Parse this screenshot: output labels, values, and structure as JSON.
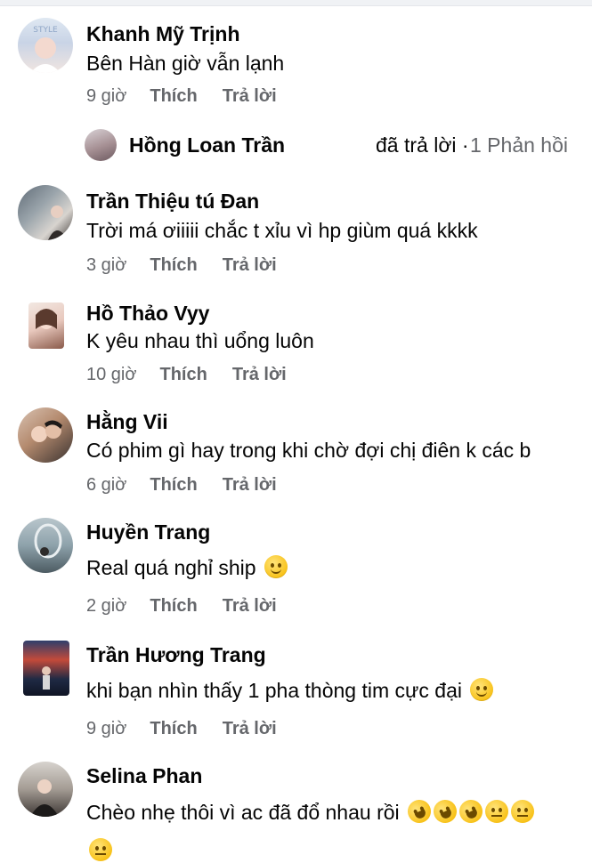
{
  "comments": [
    {
      "name": "Khanh Mỹ Trịnh",
      "text": "Bên Hàn giờ vẫn lạnh",
      "time": "9 giờ",
      "like": "Thích",
      "reply": "Trả lời",
      "avatar_icon": "profile-photo"
    },
    {
      "name": "Trần Thiệu tú Đan",
      "text": "Trời má ơiiiii chắc t xỉu vì hp giùm quá kkkk",
      "time": "3 giờ",
      "like": "Thích",
      "reply": "Trả lời",
      "avatar_icon": "profile-photo"
    },
    {
      "name": "Hồ Thảo Vyy",
      "text": "K yêu nhau thì uổng luôn",
      "time": "10 giờ",
      "like": "Thích",
      "reply": "Trả lời",
      "avatar_icon": "profile-photo"
    },
    {
      "name": "Hằng Vii",
      "text": "Có phim gì hay trong khi chờ đợi chị điên k các b",
      "time": "6 giờ",
      "like": "Thích",
      "reply": "Trả lời",
      "avatar_icon": "profile-photo"
    },
    {
      "name": "Huyền Trang",
      "text": "Real quá nghỉ ship",
      "time": "2 giờ",
      "like": "Thích",
      "reply": "Trả lời",
      "avatar_icon": "profile-photo"
    },
    {
      "name": "Trần Hương Trang",
      "text": "khi bạn nhìn thấy 1 pha thòng tim cực đại",
      "time": "9 giờ",
      "like": "Thích",
      "reply": "Trả lời",
      "avatar_icon": "profile-photo"
    },
    {
      "name": "Selina Phan",
      "text": "Chèo nhẹ thôi vì ac đã đổ nhau rồi",
      "avatar_icon": "profile-photo"
    }
  ],
  "reply_summary": {
    "name": "Hồng Loan Trần",
    "text": "đã trả lời ·",
    "count": "1 Phản hồi"
  },
  "emoji": {
    "smile": "slightly-smiling-face-icon",
    "rofl": "rolling-on-floor-laughing-icon",
    "neutral": "expressionless-face-icon"
  }
}
